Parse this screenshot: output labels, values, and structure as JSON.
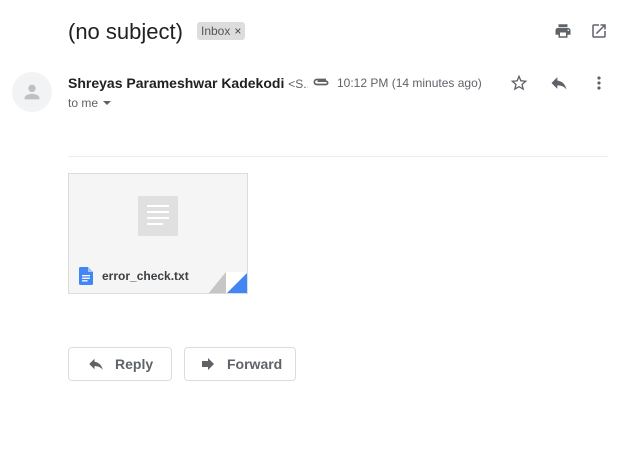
{
  "header": {
    "subject": "(no subject)",
    "label_chip": "Inbox",
    "label_remove": "×",
    "actions": [
      "print-icon",
      "open-in-new-window-icon"
    ]
  },
  "message": {
    "sender_name": "Shreyas Parameshwar Kadekodi",
    "sender_email_truncated": "<S...",
    "time": "10:12 PM (14 minutes ago)",
    "recipient": "to me",
    "icons": [
      "attachment-icon",
      "star-icon",
      "reply-icon",
      "more-vertical-icon"
    ]
  },
  "attachment": {
    "filename": "error_check.txt",
    "file_icon": "google-docs-icon",
    "accent_color": "#4285f4"
  },
  "footer": {
    "reply_label": "Reply",
    "forward_label": "Forward"
  },
  "colors": {
    "text_primary": "#202124",
    "text_secondary": "#5f6368",
    "chip_bg": "#dddddd",
    "border": "#dadce0"
  }
}
